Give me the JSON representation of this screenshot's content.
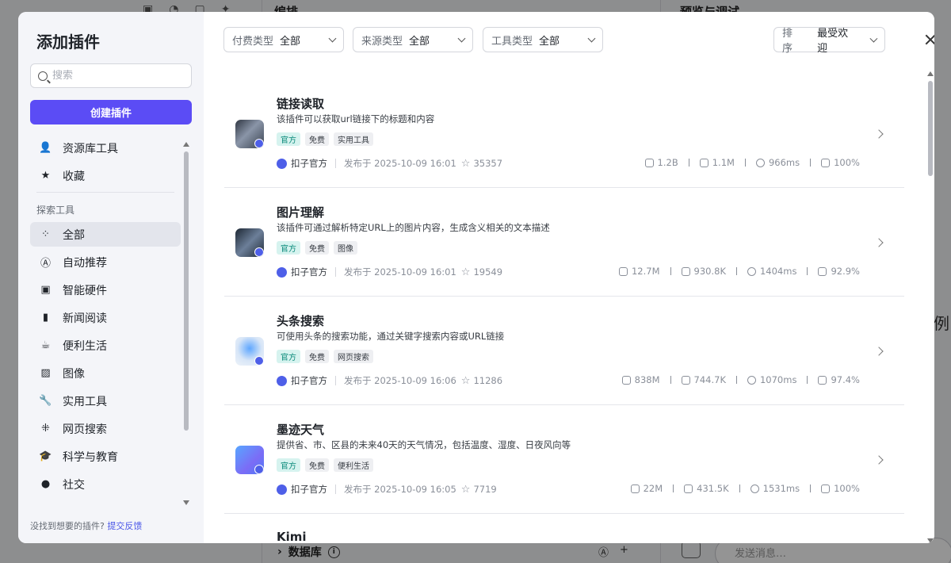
{
  "background": {
    "orchestration_title": "编排",
    "preview_title": "预览与调试",
    "database_label": "数据库",
    "chat_placeholder": "发送消息…",
    "side_char": "例"
  },
  "modal": {
    "title": "添加插件",
    "search_placeholder": "搜索",
    "create_button": "创建插件",
    "nav_top": [
      {
        "label": "资源库工具",
        "icon": "user-icon"
      },
      {
        "label": "收藏",
        "icon": "star-icon"
      }
    ],
    "explore_group_label": "探索工具",
    "nav_explore": [
      {
        "label": "全部",
        "icon": "grid-icon",
        "active": true
      },
      {
        "label": "自动推荐",
        "icon": "ai-icon"
      },
      {
        "label": "智能硬件",
        "icon": "chip-icon"
      },
      {
        "label": "新闻阅读",
        "icon": "book-icon"
      },
      {
        "label": "便利生活",
        "icon": "coffee-icon"
      },
      {
        "label": "图像",
        "icon": "image-icon"
      },
      {
        "label": "实用工具",
        "icon": "wrench-icon"
      },
      {
        "label": "网页搜索",
        "icon": "network-icon"
      },
      {
        "label": "科学与教育",
        "icon": "graduation-cap-icon"
      },
      {
        "label": "社交",
        "icon": "chat-icon"
      }
    ],
    "feedback_text": "没找到想要的插件?",
    "feedback_link": "提交反馈"
  },
  "filters": {
    "pay": {
      "label": "付费类型",
      "value": "全部"
    },
    "source": {
      "label": "来源类型",
      "value": "全部"
    },
    "tool": {
      "label": "工具类型",
      "value": "全部"
    },
    "sort": {
      "label": "排序",
      "value": "最受欢迎"
    }
  },
  "plugins": [
    {
      "name": "链接读取",
      "desc": "该插件可以获取url链接下的标题和内容",
      "tags": [
        "官方",
        "免费",
        "实用工具"
      ],
      "author": "扣子官方",
      "published": "发布于 2025-10-09 16:01",
      "favorites": "35357",
      "calls": "1.2B",
      "users": "1.1M",
      "latency": "966ms",
      "success": "100%"
    },
    {
      "name": "图片理解",
      "desc": "该插件可通过解析特定URL上的图片内容，生成含义相关的文本描述",
      "tags": [
        "官方",
        "免费",
        "图像"
      ],
      "author": "扣子官方",
      "published": "发布于 2025-10-09 16:01",
      "favorites": "19549",
      "calls": "12.7M",
      "users": "930.8K",
      "latency": "1404ms",
      "success": "92.9%"
    },
    {
      "name": "头条搜索",
      "desc": "可使用头条的搜索功能，通过关键字搜索内容或URL链接",
      "tags": [
        "官方",
        "免费",
        "网页搜索"
      ],
      "author": "扣子官方",
      "published": "发布于 2025-10-09 16:06",
      "favorites": "11286",
      "calls": "838M",
      "users": "744.7K",
      "latency": "1070ms",
      "success": "97.4%"
    },
    {
      "name": "墨迹天气",
      "desc": "提供省、市、区县的未来40天的天气情况，包括温度、湿度、日夜风向等",
      "tags": [
        "官方",
        "免费",
        "便利生活"
      ],
      "author": "扣子官方",
      "published": "发布于 2025-10-09 16:05",
      "favorites": "7719",
      "calls": "22M",
      "users": "431.5K",
      "latency": "1531ms",
      "success": "100%"
    },
    {
      "name": "Kimi"
    }
  ],
  "colors": {
    "accent": "#5b4cf5",
    "official_tag_bg": "#d6f3ef",
    "official_tag_fg": "#0a8a7a"
  }
}
